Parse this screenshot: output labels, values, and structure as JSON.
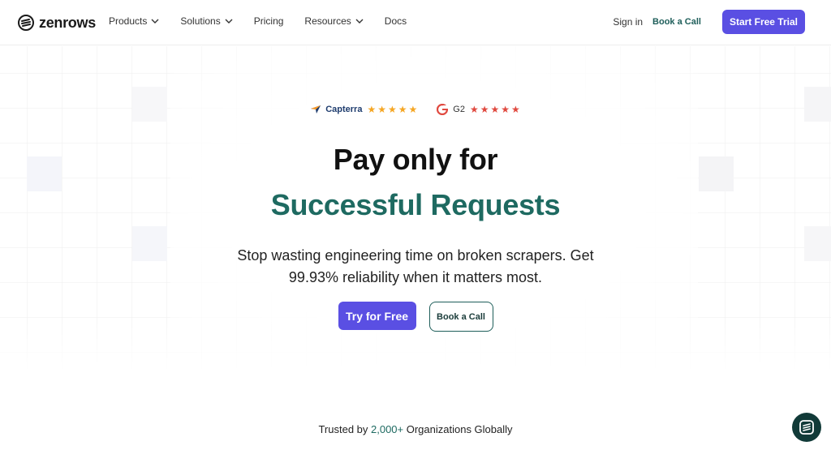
{
  "nav": {
    "logo_text": "zenrows",
    "links": [
      {
        "label": "Products",
        "dropdown": true
      },
      {
        "label": "Solutions",
        "dropdown": true
      },
      {
        "label": "Pricing",
        "dropdown": false
      },
      {
        "label": "Resources",
        "dropdown": true
      },
      {
        "label": "Docs",
        "dropdown": false
      }
    ],
    "sign_in": "Sign in",
    "book_call": "Book a Call",
    "start_trial": "Start Free Trial"
  },
  "ratings": {
    "capterra": {
      "label": "Capterra",
      "stars": 5,
      "star_color": "#f5a623"
    },
    "g2": {
      "label": "G2",
      "stars": 5,
      "star_color": "#e0493f"
    }
  },
  "hero": {
    "line1": "Pay only for",
    "line2": "Successful Requests",
    "subtitle": "Stop wasting engineering time on broken scrapers. Get 99.93% reliability when it matters most.",
    "primary_cta": "Try for Free",
    "secondary_cta": "Book a Call"
  },
  "trusted": {
    "prefix": "Trusted by ",
    "count": "2,000+",
    "suffix": " Organizations Globally"
  },
  "colors": {
    "brand_purple": "#5a4fe3",
    "brand_teal": "#1e6a61",
    "chat_bg": "#113a38"
  },
  "icons": {
    "chat": "zenrows-chat-icon",
    "chevron": "chevron-down-icon"
  }
}
